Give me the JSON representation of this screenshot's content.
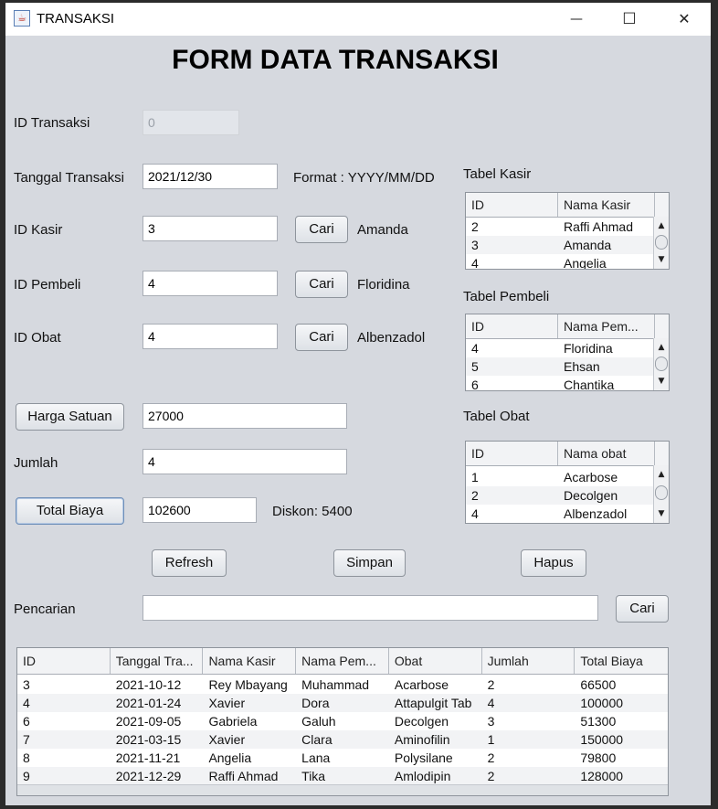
{
  "window": {
    "title": "TRANSAKSI",
    "minimize": "—",
    "maximize": "☐",
    "close": "✕",
    "app_icon": "java-cup-icon"
  },
  "heading": "FORM DATA TRANSAKSI",
  "form": {
    "id_transaksi": {
      "label": "ID Transaksi",
      "value": "0"
    },
    "tanggal": {
      "label": "Tanggal Transaksi",
      "value": "2021/12/30",
      "hint": "Format : YYYY/MM/DD"
    },
    "id_kasir": {
      "label": "ID Kasir",
      "value": "3",
      "button": "Cari",
      "result": "Amanda"
    },
    "id_pembeli": {
      "label": "ID Pembeli",
      "value": "4",
      "button": "Cari",
      "result": "Floridina"
    },
    "id_obat": {
      "label": "ID Obat",
      "value": "4",
      "button": "Cari",
      "result": "Albenzadol"
    },
    "harga_satuan": {
      "button": "Harga Satuan",
      "value": "27000"
    },
    "jumlah": {
      "label": "Jumlah",
      "value": "4"
    },
    "total_biaya": {
      "button": "Total Biaya",
      "value": "102600",
      "diskon": "Diskon: 5400"
    }
  },
  "actions": {
    "refresh": "Refresh",
    "simpan": "Simpan",
    "hapus": "Hapus"
  },
  "search": {
    "label": "Pencarian",
    "value": "",
    "button": "Cari"
  },
  "tabel_kasir": {
    "title": "Tabel Kasir",
    "columns": [
      "ID",
      "Nama Kasir"
    ],
    "rows": [
      [
        "2",
        "Raffi Ahmad"
      ],
      [
        "3",
        "Amanda"
      ],
      [
        "4",
        "Angelia"
      ]
    ]
  },
  "tabel_pembeli": {
    "title": "Tabel Pembeli",
    "columns": [
      "ID",
      "Nama Pem..."
    ],
    "rows": [
      [
        "4",
        "Floridina"
      ],
      [
        "5",
        "Ehsan"
      ],
      [
        "6",
        "Chantika"
      ]
    ]
  },
  "tabel_obat": {
    "title": "Tabel Obat",
    "columns": [
      "ID",
      "Nama obat"
    ],
    "rows": [
      [
        "1",
        "Acarbose"
      ],
      [
        "2",
        "Decolgen"
      ],
      [
        "4",
        "Albenzadol"
      ]
    ]
  },
  "tabel_transaksi": {
    "columns": [
      "ID",
      "Tanggal Tra...",
      "Nama Kasir",
      "Nama Pem...",
      "Obat",
      "Jumlah",
      "Total Biaya"
    ],
    "rows": [
      [
        "3",
        "2021-10-12",
        "Rey Mbayang",
        "Muhammad",
        "Acarbose",
        "2",
        "66500"
      ],
      [
        "4",
        "2021-01-24",
        "Xavier",
        "Dora",
        "Attapulgit Tab",
        "4",
        "100000"
      ],
      [
        "6",
        "2021-09-05",
        "Gabriela",
        "Galuh",
        "Decolgen",
        "3",
        "51300"
      ],
      [
        "7",
        "2021-03-15",
        "Xavier",
        "Clara",
        "Aminofilin",
        "1",
        "150000"
      ],
      [
        "8",
        "2021-11-21",
        "Angelia",
        "Lana",
        "Polysilane",
        "2",
        "79800"
      ],
      [
        "9",
        "2021-12-29",
        "Raffi Ahmad",
        "Tika",
        "Amlodipin",
        "2",
        "128000"
      ]
    ]
  },
  "scroll_arrows": {
    "up": "▲",
    "down": "▼"
  }
}
